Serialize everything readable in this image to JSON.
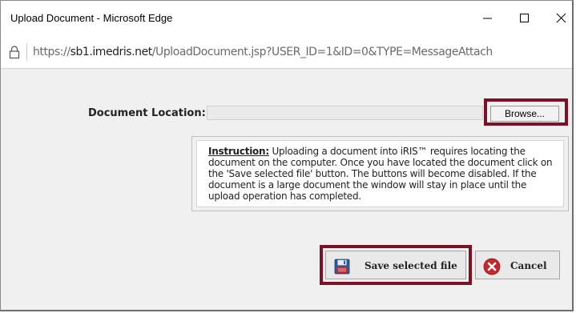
{
  "window": {
    "title": "Upload Document - Microsoft Edge"
  },
  "addressbar": {
    "url_prefix": "https://",
    "url_host": "sb1.imedris.net",
    "url_path": "/UploadDocument.jsp?USER_ID=1&ID=0&TYPE=MessageAttach",
    "icon": "lock-icon"
  },
  "form": {
    "document_location_label": "Document Location:",
    "document_location_value": "",
    "browse_label": "Browse..."
  },
  "instruction": {
    "title": "Instruction:",
    "text": " Uploading a document into iRIS™ requires locating the document on the computer. Once you have located the document click on the 'Save selected file' button. The buttons will become disabled. If the document is a large document the window will stay in place until the upload operation has completed."
  },
  "actions": {
    "save_label": "Save selected file",
    "cancel_label": "Cancel"
  },
  "colors": {
    "highlight": "#7b1126",
    "cancel_icon": "#c7282b"
  }
}
